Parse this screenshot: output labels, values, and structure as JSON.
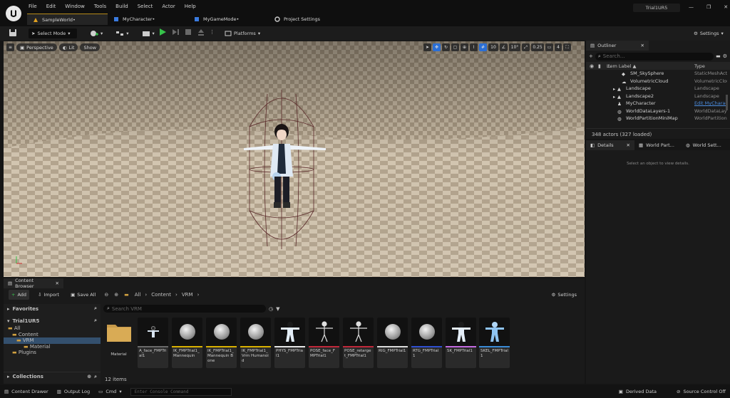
{
  "menu": [
    "File",
    "Edit",
    "Window",
    "Tools",
    "Build",
    "Select",
    "Actor",
    "Help"
  ],
  "tabs": {
    "world": "SampleWorld•",
    "character": "MyCharacter•",
    "gamemode": "MyGameMode•",
    "project": "Project Settings"
  },
  "project_name": "Trial1UR5",
  "toolbar": {
    "select_mode": "Select Mode",
    "platforms": "Platforms",
    "settings": "Settings"
  },
  "viewport": {
    "perspective": "Perspective",
    "lit": "Lit",
    "show": "Show",
    "grid": "10",
    "angle": "10°",
    "scale": "0.25",
    "cameras": "4"
  },
  "outliner": {
    "title": "Outliner",
    "search_placeholder": "Search...",
    "col_label": "Item Label ▲",
    "col_type": "Type",
    "rows": [
      {
        "label": "SM_SkySphere",
        "type": "StaticMeshAct"
      },
      {
        "label": "VolumetricCloud",
        "type": "VolumetricCloud"
      },
      {
        "label": "Landscape",
        "type": "Landscape"
      },
      {
        "label": "Landscape2",
        "type": "Landscape"
      },
      {
        "label": "MyCharacter",
        "type": "Edit MyCharacter"
      },
      {
        "label": "WorldDataLayers-1",
        "type": "WorldDataLay"
      },
      {
        "label": "WorldPartitionMiniMap",
        "type": "WorldPartition"
      }
    ],
    "status": "348 actors (327 loaded)"
  },
  "details": {
    "tabs": [
      "Details",
      "World Part...",
      "World Sett..."
    ],
    "empty": "Select an object to view details."
  },
  "content_browser": {
    "title": "Content Browser",
    "add": "Add",
    "import": "Import",
    "save_all": "Save All",
    "breadcrumb": [
      "All",
      "Content",
      "VRM"
    ],
    "settings": "Settings",
    "favorites": "Favorites",
    "project": "Trial1UR5",
    "tree": [
      "All",
      "Content",
      "VRM",
      "Material",
      "Plugins"
    ],
    "collections": "Collections",
    "search_placeholder": "Search VRM",
    "count": "12 items",
    "assets": [
      {
        "name": "Material",
        "kind": "folder",
        "color": "#00000000"
      },
      {
        "name": "A_face_FMPTrial1",
        "kind": "figure",
        "color": "#6a6a6a"
      },
      {
        "name": "IK_FMPTrial1_Mannequin",
        "kind": "cube",
        "color": "#d9b100"
      },
      {
        "name": "IK_FMPTrial1_Mannequin Bone",
        "kind": "cube",
        "color": "#d9b100"
      },
      {
        "name": "IK_FMPTrial1_Vrm Humanoid",
        "kind": "cube",
        "color": "#d9b100"
      },
      {
        "name": "PHYS_FMPTrial1",
        "kind": "figure",
        "color": "#e6e6e6"
      },
      {
        "name": "POSE_face_FMPTrial1",
        "kind": "skeleton",
        "color": "#c0283a"
      },
      {
        "name": "POSE_retarget_FMPTrial1",
        "kind": "skeleton",
        "color": "#c0283a"
      },
      {
        "name": "RIG_FMPTrial1",
        "kind": "cube",
        "color": "#dcdcdc"
      },
      {
        "name": "RTG_FMPTrial1",
        "kind": "cube",
        "color": "#2f4fd0"
      },
      {
        "name": "SK_FMPTrial1",
        "kind": "figure",
        "color": "#c36be0"
      },
      {
        "name": "SKEL_FMPTrial1",
        "kind": "figure",
        "color": "#3a8bd6"
      }
    ]
  },
  "statusbar": {
    "drawer": "Content Drawer",
    "output": "Output Log",
    "cmd": "Cmd",
    "console_placeholder": "Enter Console Command",
    "derived": "Derived Data",
    "source": "Source Control Off"
  }
}
